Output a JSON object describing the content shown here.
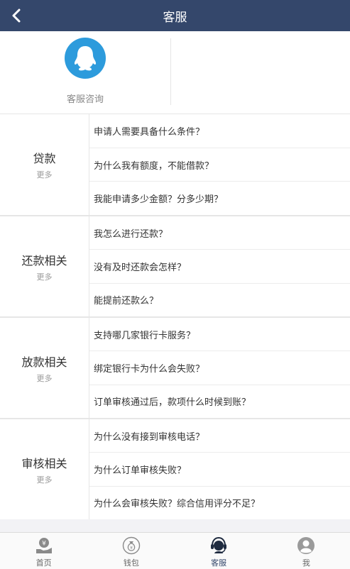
{
  "header": {
    "title": "客服"
  },
  "service": {
    "label": "客服咨询"
  },
  "sections": [
    {
      "title": "贷款",
      "more": "更多",
      "questions": [
        "申请人需要具备什么条件？",
        "为什么我有额度，不能借款？",
        "我能申请多少金额？分多少期？"
      ]
    },
    {
      "title": "还款相关",
      "more": "更多",
      "questions": [
        "我怎么进行还款？",
        "没有及时还款会怎样？",
        "能提前还款么？"
      ]
    },
    {
      "title": "放款相关",
      "more": "更多",
      "questions": [
        "支持哪几家银行卡服务？",
        "绑定银行卡为什么会失败？",
        "订单审核通过后，款项什么时候到账？"
      ]
    },
    {
      "title": "审核相关",
      "more": "更多",
      "questions": [
        "为什么没有接到审核电话？",
        "为什么订单审核失败？",
        "为什么会审核失败？综合信用评分不足？"
      ]
    }
  ],
  "tabbar": {
    "active_index": 2,
    "items": [
      {
        "label": "首页",
        "icon": "home-money-icon"
      },
      {
        "label": "钱包",
        "icon": "wallet-bag-icon"
      },
      {
        "label": "客服",
        "icon": "customer-service-icon"
      },
      {
        "label": "我",
        "icon": "user-icon"
      }
    ]
  },
  "colors": {
    "header_bg": "#34476b",
    "qq_blue": "#2d9bdc",
    "tab_active": "#34476b"
  }
}
